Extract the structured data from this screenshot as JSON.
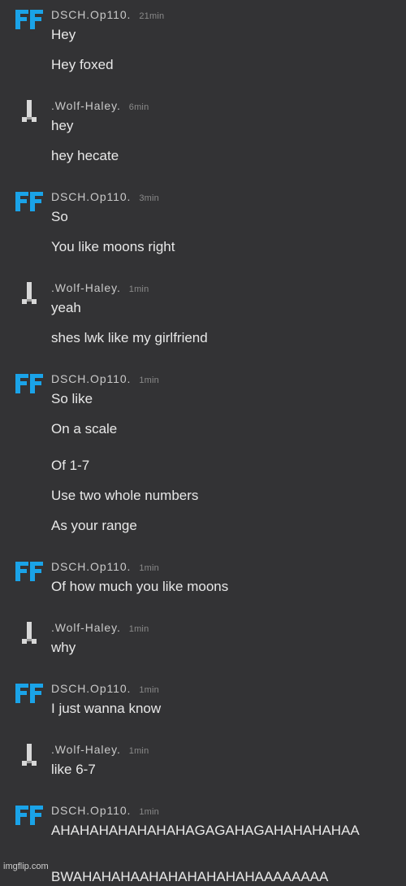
{
  "users": {
    "dsch": {
      "name": "DSCH.Op110.",
      "avatar_icon": "ff-logo-icon",
      "avatar_color": "#1aa3e8"
    },
    "wolf": {
      "name": ".Wolf-Haley.",
      "avatar_icon": "pixel-sword-icon",
      "avatar_color": "#d8d8d8"
    }
  },
  "messages": [
    {
      "time": "21min",
      "lines": [
        "Hey",
        "Hey foxed"
      ]
    },
    {
      "time": "6min",
      "lines": [
        "hey",
        "hey hecate"
      ]
    },
    {
      "time": "3min",
      "lines": [
        "So",
        "You like moons right"
      ]
    },
    {
      "time": "1min",
      "lines": [
        "yeah",
        "shes lwk like my girlfriend"
      ]
    },
    {
      "time": "1min",
      "lines": [
        "So like",
        "On a scale",
        "Of 1-7",
        "Use two whole numbers",
        "As your range"
      ]
    },
    {
      "time": "1min",
      "lines": [
        "Of how much you like moons"
      ]
    },
    {
      "time": "1min",
      "lines": [
        "why"
      ]
    },
    {
      "time": "1min",
      "lines": [
        "I just wanna know"
      ]
    },
    {
      "time": "1min",
      "lines": [
        "like 6-7"
      ]
    },
    {
      "time": "1min",
      "lines": [
        "AHAHAHAHAHAHAHAGAGAHAGAHAHAHAHAA",
        "BWAHAHAHAAHAHAHAHAHAHAAAAAAAA"
      ]
    }
  ],
  "watermark": "imgflip.com"
}
